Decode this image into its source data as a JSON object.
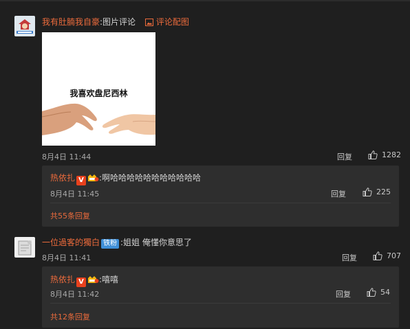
{
  "comments": [
    {
      "user": "我有肚腩我自豪",
      "text": ":图片评论",
      "image_link": "评论配图",
      "image_caption": "我喜欢盘尼西林",
      "date": "8月4日 11:44",
      "reply_label": "回复",
      "likes": "1282",
      "subreply": {
        "user": "热依扎",
        "text": ":啊哈哈哈哈哈哈哈哈哈哈哈",
        "date": "8月4日 11:45",
        "reply_label": "回复",
        "likes": "225",
        "more_label": "共55条回复"
      }
    },
    {
      "user": "一位過客的獨白",
      "badge": "铁粉",
      "text": ":姐姐 俺懂你意思了",
      "date": "8月4日 11:41",
      "reply_label": "回复",
      "likes": "707",
      "subreply": {
        "user": "热依扎",
        "text": ":嘻嘻",
        "date": "8月4日 11:42",
        "reply_label": "回复",
        "likes": "54",
        "more_label": "共12条回复"
      }
    }
  ],
  "colors": {
    "background": "#1f1f1f",
    "panel": "#2e2e2e",
    "username": "#ec6b3c",
    "badge_blue": "#3f8fd8",
    "v_badge": "#e8411d"
  },
  "icons": [
    "image-icon",
    "thumb-up-icon",
    "verified-v-icon",
    "fan-badge-icon"
  ]
}
